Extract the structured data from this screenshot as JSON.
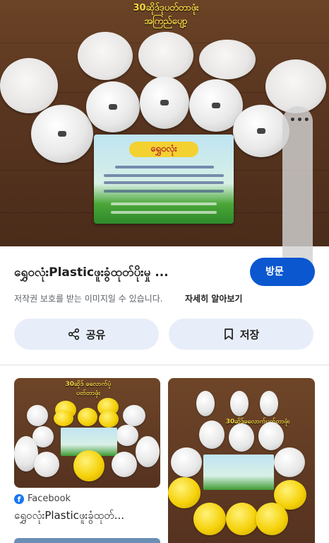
{
  "hero": {
    "banner_line1": "30ဆိုဒ်ဒုပတ်တာဖုံး",
    "banner_line2": "အကြည်ပျော့",
    "card_brand": "ရွှေဝလုံး"
  },
  "side_fab": {
    "menu_icon": "more-horiz-icon",
    "toggle_icon": "lens-off-icon"
  },
  "result": {
    "title": "ရွှေဝလုံးPlasticဖူးခွံထုတ်ပိုးမှု ...",
    "visit_label": "방문",
    "copyright_notice": "저작권 보호를 받는 이미지일 수 있습니다.",
    "learn_more": "자세히 알아보기"
  },
  "actions": {
    "share_label": "공유",
    "save_label": "저장"
  },
  "related": [
    {
      "banner_line1": "30ဆိုဒ် ခလောက်ပုံ",
      "banner_line2": "ပတ်တာဖုံး",
      "source": "Facebook",
      "title": "ရွှေဝလုံးPlasticဖူးခွံထုတ်..."
    },
    {
      "banner_line1": "30ဆိုဒ်ခလောက်ပတ်တာဖုံး"
    }
  ],
  "colors": {
    "accent": "#0b57d0",
    "button_bg": "#e8eef9",
    "facebook": "#1877f2"
  }
}
